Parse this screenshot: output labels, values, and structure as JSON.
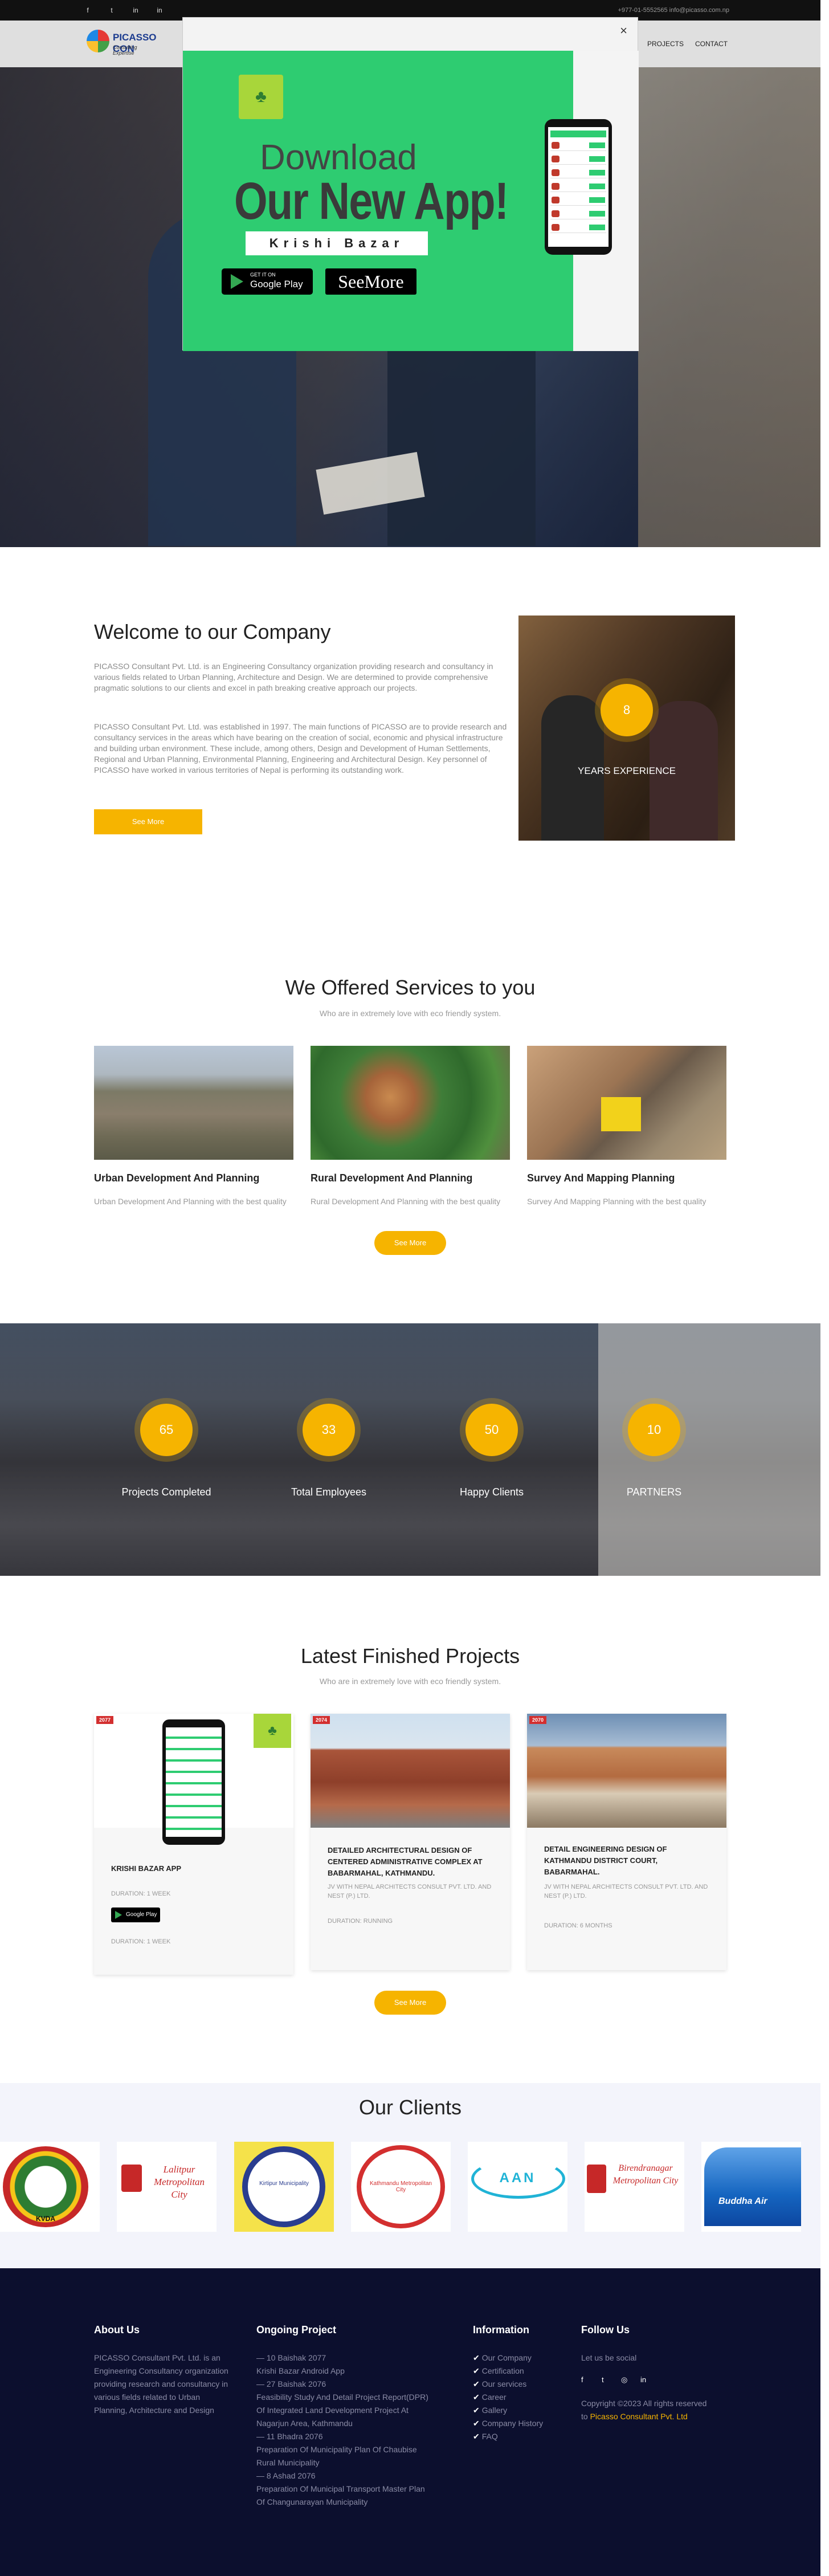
{
  "topbar": {
    "social": [
      "f",
      "t",
      "in",
      "in"
    ],
    "contact": "+977-01-5552565  info@picasso.com.np"
  },
  "nav": {
    "logo_title": "PICASSO CON",
    "logo_subtitle": "Consulting Expertise",
    "menu": [
      "PROJECTS",
      "CONTACT"
    ]
  },
  "modal": {
    "close": "×",
    "heading_small": "Download",
    "heading_big": "Our New App!",
    "app_name": "Krishi Bazar",
    "google_play_small": "GET IT ON",
    "google_play_big": "Google Play",
    "see_more": "SeeMore"
  },
  "welcome": {
    "title": "Welcome to our Company",
    "para1": "PICASSO Consultant Pvt. Ltd. is an Engineering Consultancy organization providing research and consultancy in various fields related to Urban Planning, Architecture and Design. We are determined to provide comprehensive pragmatic solutions to our clients and excel in path breaking creative approach our projects.",
    "para2": "PICASSO Consultant Pvt. Ltd. was established in 1997. The main functions of PICASSO are to provide research and consultancy services in the areas which have bearing on the creation of social, economic and physical infrastructure and building urban environment. These include, among others, Design and Development of Human Settlements, Regional and Urban Planning, Environmental Planning, Engineering and Architectural Design. Key personnel of PICASSO have worked in various territories of Nepal is performing its outstanding work.",
    "button": "See More",
    "years_value": "8",
    "years_label": "YEARS EXPERIENCE"
  },
  "services": {
    "title": "We Offered Services to you",
    "subtitle": "Who are in extremely love with eco friendly system.",
    "items": [
      {
        "title": "Urban Development And Planning",
        "desc": "Urban Development And Planning with the best quality"
      },
      {
        "title": "Rural Development And Planning",
        "desc": "Rural Development And Planning with the best quality"
      },
      {
        "title": "Survey And Mapping Planning",
        "desc": "Survey And Mapping Planning with the best quality"
      }
    ],
    "button": "See More"
  },
  "stats": [
    {
      "value": "65",
      "label": "Projects Completed"
    },
    {
      "value": "33",
      "label": "Total Employees"
    },
    {
      "value": "50",
      "label": "Happy Clients"
    },
    {
      "value": "10",
      "label": "PARTNERS"
    }
  ],
  "projects": {
    "title": "Latest Finished Projects",
    "subtitle": "Who are in extremely love with eco friendly system.",
    "items": [
      {
        "year": "2077",
        "title": "KRISHI BAZAR APP",
        "duration": "DURATION: 1 WEEK",
        "duration2": "DURATION: 1 WEEK",
        "play": "Google Play"
      },
      {
        "year": "2074",
        "title": "DETAILED ARCHITECTURAL DESIGN OF CENTERED ADMINISTRATIVE COMPLEX AT BABARMAHAL, KATHMANDU.",
        "firm": "JV WITH NEPAL ARCHITECTS CONSULT PVT. LTD. AND NEST (P.) LTD.",
        "duration": "DURATION: RUNNING"
      },
      {
        "year": "2070",
        "title": "DETAIL ENGINEERING DESIGN OF KATHMANDU DISTRICT COURT, BABARMAHAL.",
        "firm": "JV WITH NEPAL ARCHITECTS CONSULT PVT. LTD. AND NEST (P.) LTD.",
        "duration": "DURATION: 6 MONTHS"
      }
    ],
    "button": "See More"
  },
  "clients": {
    "title": "Our Clients",
    "logos": [
      "KVDA",
      "Lalitpur Metropolitan City",
      "Kirtipur Municipality",
      "Kathmandu Metropolitan City",
      "AAN",
      "Birendranagar Metropolitan City",
      "Buddha Air"
    ]
  },
  "footer": {
    "about_title": "About Us",
    "about_text": "PICASSO Consultant Pvt. Ltd. is an Engineering Consultancy organization providing research and consultancy in various fields related to Urban Planning, Architecture and Design",
    "ongoing_title": "Ongoing Project",
    "ongoing_lines": [
      "— 10 Baishak 2077",
      "Krishi Bazar Android App",
      "— 27 Baishak 2076",
      "Feasibility Study And Detail Project Report(DPR)",
      "Of Integrated Land Development Project At",
      "Nagarjun Area, Kathmandu",
      "— 11 Bhadra 2076",
      "Preparation Of Municipality Plan Of Chaubise",
      "Rural Municipality",
      "— 8 Ashad 2076",
      "Preparation Of Municipal Transport Master Plan",
      "Of Changunarayan Municipality"
    ],
    "info_title": "Information",
    "info_links": [
      "Our Company",
      "Certification",
      "Our services",
      "Career",
      "Gallery",
      "Company History",
      "FAQ"
    ],
    "follow_title": "Follow Us",
    "follow_text": "Let us be social",
    "follow_icons": [
      "f",
      "t",
      "◎",
      "in"
    ],
    "copyright": "Copyright ©2023 All rights reserved",
    "copyright_to": "to",
    "copyright_link": "Picasso Consultant Pvt. Ltd"
  },
  "colors": {
    "accent": "#f6b400",
    "green": "#2ecc71",
    "footer_bg": "#0c0f2e"
  }
}
